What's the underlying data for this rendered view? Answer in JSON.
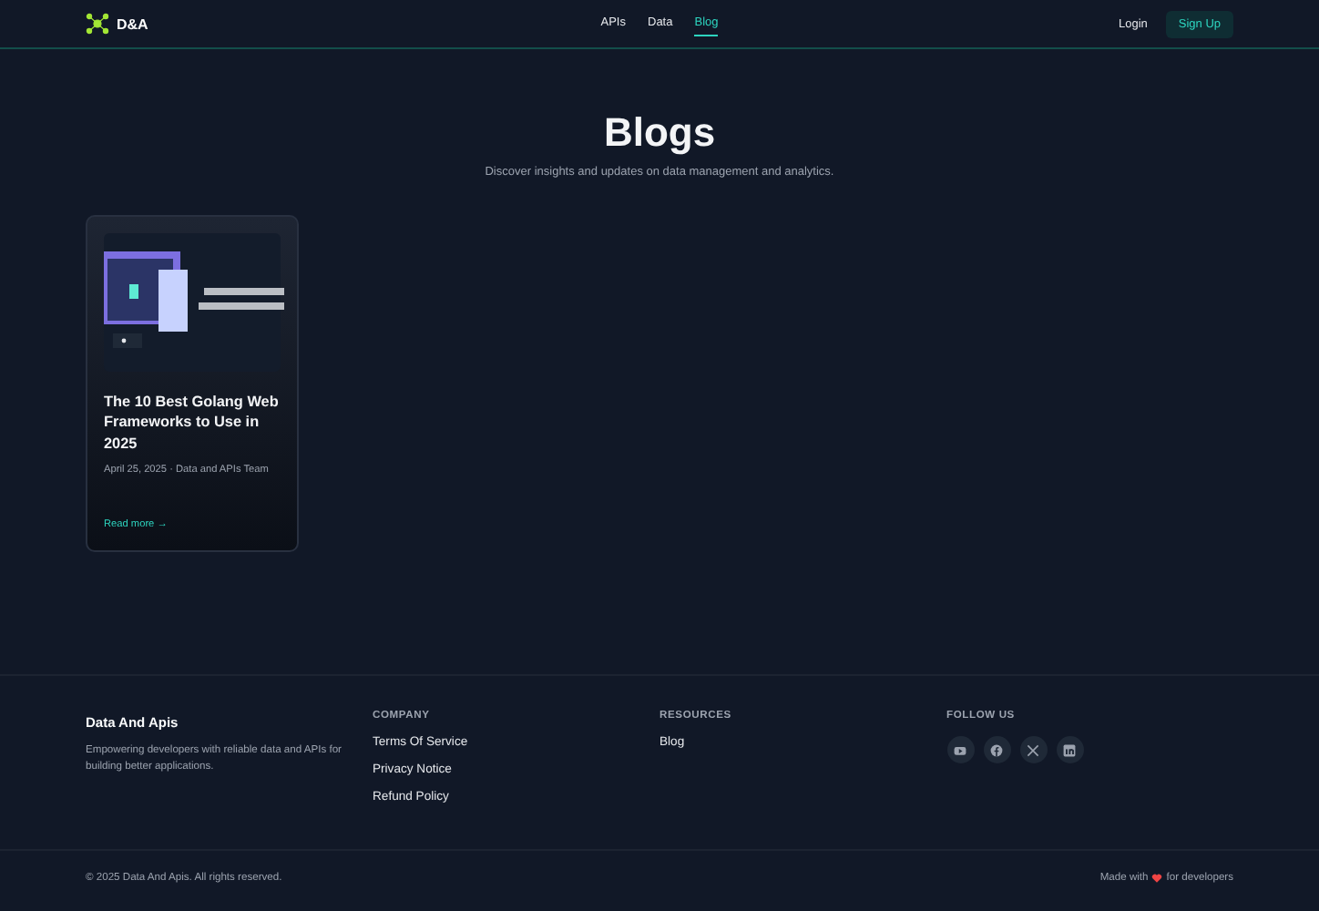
{
  "header": {
    "logo_text": "D&A",
    "nav": [
      {
        "label": "APIs",
        "selected": false
      },
      {
        "label": "Data",
        "selected": false
      },
      {
        "label": "Blog",
        "selected": true
      }
    ],
    "login": "Login",
    "signup": "Sign Up"
  },
  "hero": {
    "title": "Blogs",
    "subtitle": "Discover insights and updates on data management and analytics."
  },
  "posts": [
    {
      "title": "The 10 Best Golang Web Frameworks to Use in 2025",
      "meta": "April 25, 2025 · Data and APIs Team",
      "link": "Read more →"
    }
  ],
  "footer": {
    "brand": "Data And Apis",
    "tagline": "Empowering developers with reliable data and APIs for building better applications.",
    "columns": [
      {
        "heading": "COMPANY",
        "links": [
          "Terms Of Service",
          "Privacy Notice",
          "Refund Policy"
        ]
      },
      {
        "heading": "RESOURCES",
        "links": [
          "Blog"
        ]
      }
    ],
    "social_heading": "FOLLOW US",
    "social": [
      {
        "kind": "youtube"
      },
      {
        "kind": "facebook"
      },
      {
        "kind": "x"
      },
      {
        "kind": "linkedin"
      }
    ],
    "copyright": "© 2025 Data And Apis. All rights reserved.",
    "made_with": "Made with",
    "made_for": "for developers"
  }
}
